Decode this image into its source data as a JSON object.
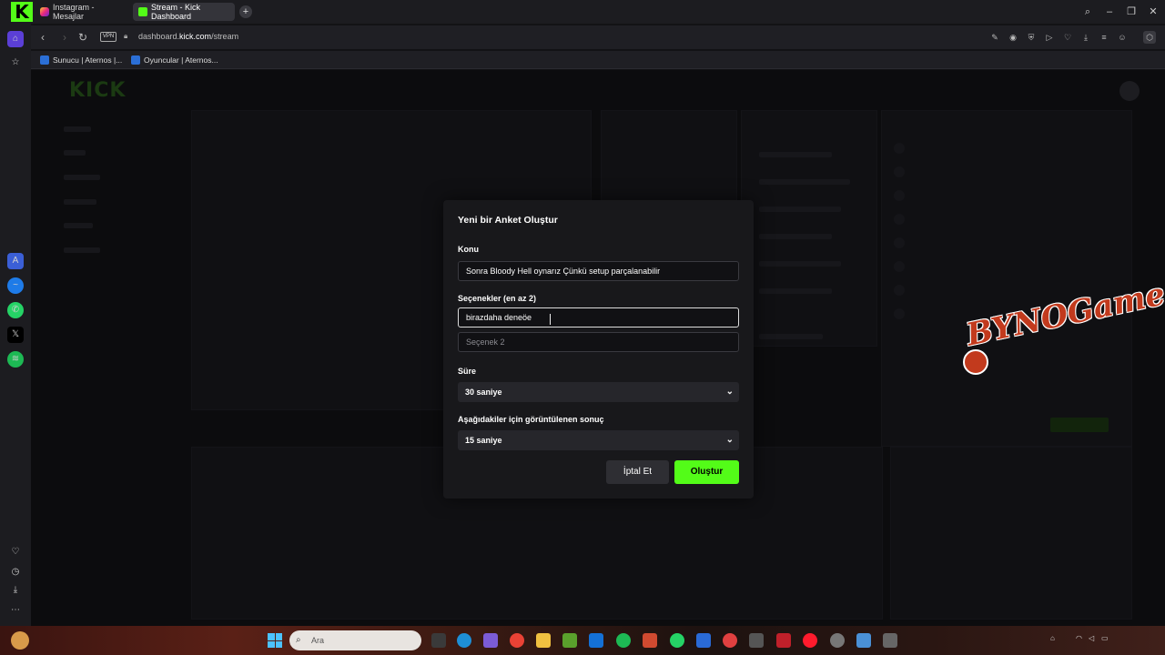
{
  "browser": {
    "tabs": [
      {
        "label": "Instagram - Mesajlar",
        "icon": "instagram-icon"
      },
      {
        "label": "Stream - Kick Dashboard",
        "icon": "kick-icon",
        "active": true
      }
    ],
    "url_prefix": "dashboard.",
    "url_domain": "kick.com",
    "url_path": "/stream",
    "vpn_label": "VPN",
    "bookmarks": [
      {
        "label": "Sunucu | Aternos |..."
      },
      {
        "label": "Oyuncular | Aternos..."
      }
    ],
    "new_tab": "+"
  },
  "background": {
    "logo": "KICK"
  },
  "watermark": {
    "text": "BYNOGame"
  },
  "modal": {
    "title": "Yeni bir Anket Oluştur",
    "topic_label": "Konu",
    "topic_value": "Sonra Bloody Hell oynarız Çünkü setup parçalanabilir",
    "options_label": "Seçenekler (en az 2)",
    "option1_value": "birazdaha deneöe",
    "option2_placeholder": "Seçenek 2",
    "duration_label": "Süre",
    "duration_value": "30 saniye",
    "result_label": "Aşağıdakiler için görüntülenen sonuç",
    "result_value": "15 saniye",
    "cancel_label": "İptal Et",
    "create_label": "Oluştur"
  },
  "taskbar": {
    "search_placeholder": "Ara"
  },
  "colors": {
    "accent": "#53fc18",
    "modal_bg": "#18181b",
    "page_bg": "#0c0c0e"
  }
}
